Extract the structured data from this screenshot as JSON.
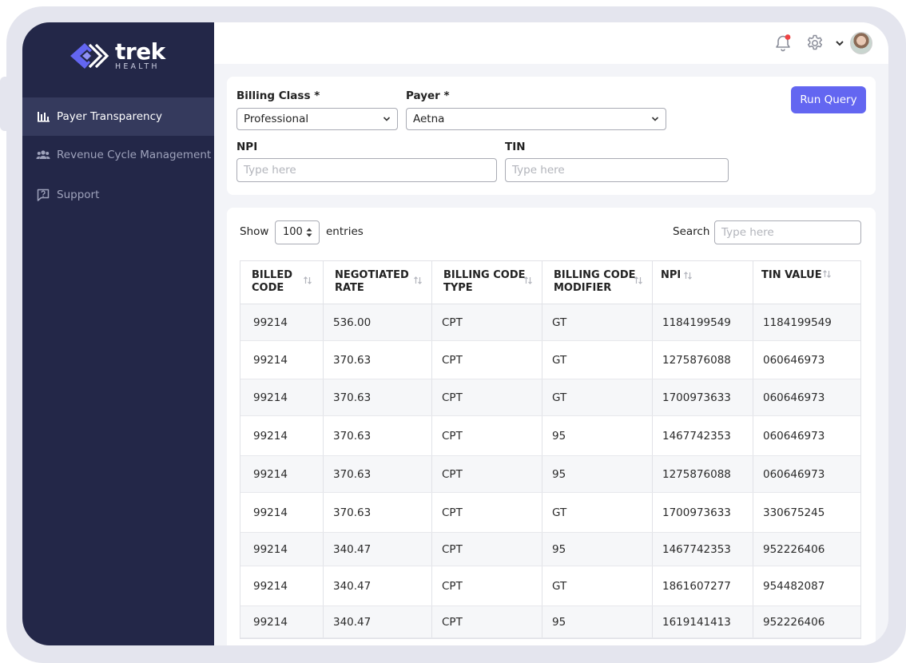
{
  "brand": {
    "name": "trek",
    "sub": "HEALTH",
    "accent": "#6366f1",
    "sidebar_bg": "#232748"
  },
  "sidebar": {
    "items": [
      {
        "label": "Payer Transparency",
        "icon": "bar-chart-icon",
        "active": true
      },
      {
        "label": "Revenue Cycle Management",
        "icon": "users-icon",
        "active": false
      },
      {
        "label": "Support",
        "icon": "help-chat-icon",
        "active": false
      }
    ]
  },
  "header": {
    "icons": [
      "bell-icon",
      "gear-icon",
      "chevron-down-icon",
      "avatar"
    ]
  },
  "filters": {
    "billing_class": {
      "label": "Billing Class *",
      "value": "Professional"
    },
    "payer": {
      "label": "Payer *",
      "value": "Aetna"
    },
    "npi": {
      "label": "NPI",
      "placeholder": "Type here"
    },
    "tin": {
      "label": "TIN",
      "placeholder": "Type here"
    },
    "run_button": "Run Query"
  },
  "results": {
    "show_label": "Show",
    "entries_value": "100",
    "entries_label": "entries",
    "search_label": "Search",
    "search_placeholder": "Type here",
    "columns": [
      [
        "BILLED",
        "CODE"
      ],
      [
        "NEGOTIATED",
        "RATE"
      ],
      [
        "BILLING CODE",
        "TYPE"
      ],
      [
        "BILLING CODE",
        "MODIFIER"
      ],
      [
        "NPI",
        ""
      ],
      [
        "TIN VALUE",
        ""
      ]
    ],
    "rows": [
      [
        "99214",
        "536.00",
        "CPT",
        "GT",
        "1184199549",
        "1184199549"
      ],
      [
        "99214",
        "370.63",
        "CPT",
        "GT",
        "1275876088",
        "060646973"
      ],
      [
        "99214",
        "370.63",
        "CPT",
        "GT",
        "1700973633",
        "060646973"
      ],
      [
        "99214",
        "370.63",
        "CPT",
        "95",
        "1467742353",
        "060646973"
      ],
      [
        "99214",
        "370.63",
        "CPT",
        "95",
        "1275876088",
        "060646973"
      ],
      [
        "99214",
        "370.63",
        "CPT",
        "GT",
        "1700973633",
        "330675245"
      ],
      [
        "99214",
        "340.47",
        "CPT",
        "95",
        "1467742353",
        "952226406"
      ],
      [
        "99214",
        "340.47",
        "CPT",
        "GT",
        "1861607277",
        "954482087"
      ],
      [
        "99214",
        "340.47",
        "CPT",
        "95",
        "1619141413",
        "952226406"
      ]
    ]
  }
}
